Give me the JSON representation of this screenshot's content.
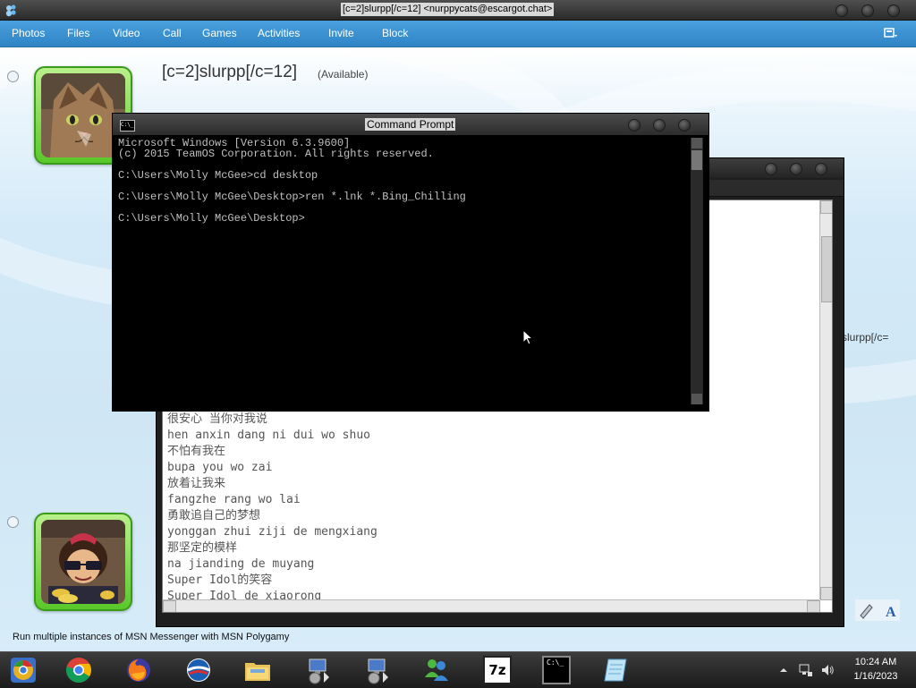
{
  "window": {
    "title": "[c=2]slurpp[/c=12] <nurppycats@escargot.chat>"
  },
  "menu": {
    "items": [
      "Photos",
      "Files",
      "Video",
      "Call",
      "Games",
      "Activities",
      "Invite",
      "Block"
    ]
  },
  "contact": {
    "name": "[c=2]slurpp[/c=12]",
    "status": "(Available)",
    "name_clipped": "slurpp[/c="
  },
  "cmd": {
    "title": "Command Prompt",
    "icon_text": "C:\\_",
    "lines": [
      "Microsoft Windows [Version 6.3.9600]",
      "(c) 2015 TeamOS Corporation. All rights reserved.",
      "",
      "C:\\Users\\Molly McGee>cd desktop",
      "",
      "C:\\Users\\Molly McGee\\Desktop>ren *.lnk *.Bing_Chilling",
      "",
      "C:\\Users\\Molly McGee\\Desktop>"
    ]
  },
  "lyrics": [
    "很安心 当你对我说",
    "hen anxin dang ni dui wo shuo",
    "不怕有我在",
    "bupa you wo zai",
    "放着让我来",
    "fangzhe rang wo lai",
    "勇敢追自己的梦想",
    "yonggan zhui ziji de mengxiang",
    "那坚定的模样",
    "na jianding de muyang",
    "Super Idol的笑容",
    "Super Idol de xiaorong"
  ],
  "promo": "Run multiple instances of MSN Messenger with MSN Polygamy",
  "taskbar": {
    "apps": [
      "chrome-canary",
      "chrome",
      "firefox",
      "ie",
      "file-explorer",
      "network-setup",
      "network-setup-2",
      "messenger",
      "7zip",
      "cmd",
      "notepad"
    ],
    "seven_zip_label": "7z",
    "cmd_label": "C:\\_"
  },
  "clock": {
    "time": "10:24 AM",
    "date": "1/16/2023"
  },
  "colors": {
    "menu_bar": "#3b93d3",
    "avatar_frame": "#6fd03a",
    "cmd_text": "#c0c0c0"
  }
}
